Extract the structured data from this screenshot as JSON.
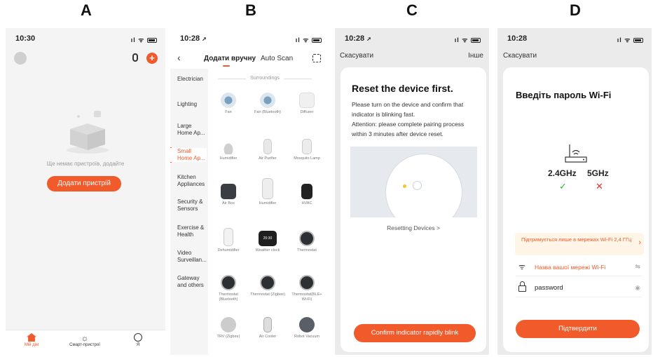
{
  "labels": [
    "A",
    "B",
    "C",
    "D"
  ],
  "panelA": {
    "time": "10:30",
    "empty_text": "Ще немає пристроїв, додайте",
    "add_button": "Додати пристрій",
    "tabs": [
      "Мій дім",
      "Смарт-пристрої",
      "Я"
    ]
  },
  "panelB": {
    "time": "10:28",
    "tab_manual": "Додати вручну",
    "tab_auto": "Auto Scan",
    "section": "Surroundings",
    "categories": [
      "Electrician",
      "Lighting",
      "Large Home Ap...",
      "Small Home Ap...",
      "Kitchen Appliances",
      "Security & Sensors",
      "Exercise & Health",
      "Video Surveillan...",
      "Gateway and others"
    ],
    "devices": [
      "Fan",
      "Fan (Bluetooth)",
      "Diffuser",
      "Humidifier",
      "Air Purifier",
      "Mosquito Lamp",
      "Air Box",
      "Humidifier",
      "HVAC",
      "Dehumidifier",
      "Weather clock",
      "Thermostat",
      "Thermostat (Bluetooth)",
      "Thermostat (Zigbee)",
      "Thermostat(BLE+ Wi-Fi)",
      "TRV (Zigbee)",
      "Air Cooler",
      "Robot Vacuum"
    ]
  },
  "panelC": {
    "time": "10:28",
    "cancel": "Скасувати",
    "other": "Інше",
    "title": "Reset the device first.",
    "line1": "Please turn on the device and confirm that",
    "line2": "indicator is blinking fast.",
    "line3": "Attention: please complete pairing process",
    "line4": "within 3 minutes after device reset.",
    "link": "Resetting Devices >",
    "confirm": "Confirm indicator rapidly blink"
  },
  "panelD": {
    "time": "10:28",
    "cancel": "Скасувати",
    "title": "Введіть пароль Wi-Fi",
    "band1": "2.4GHz",
    "band2": "5GHz",
    "warning": "Підтримується лише в мережах Wi-Fi 2,4 ГГц",
    "network": "Назва вашої мережі Wi-Fi",
    "password": "password",
    "confirm": "Підтвердити"
  },
  "colors": {
    "accent": "#f15a2b",
    "ok": "#2eb135",
    "bad": "#e5352b"
  }
}
